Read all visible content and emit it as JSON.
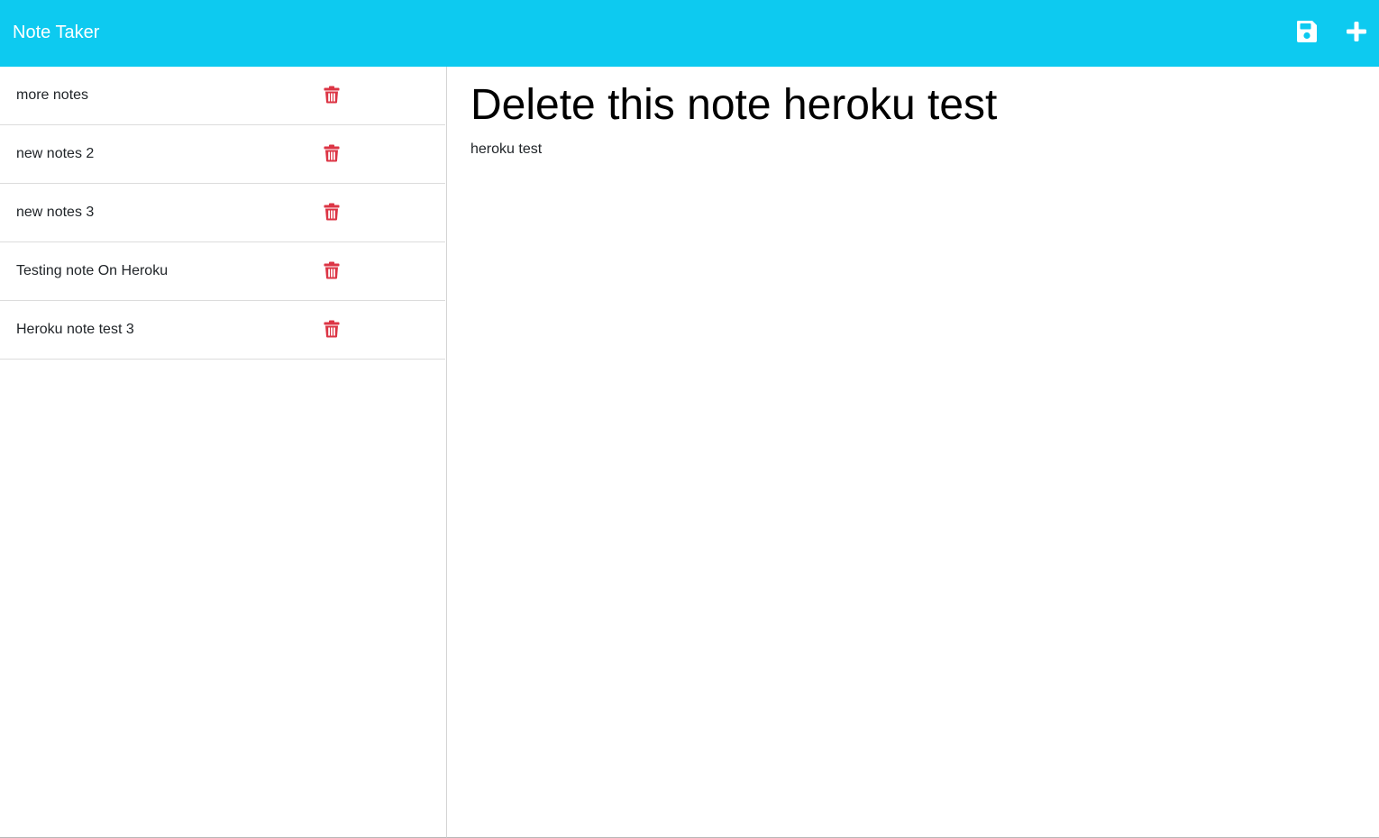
{
  "navbar": {
    "brand": "Note Taker",
    "save_icon": "floppy-disk-icon",
    "new_icon": "plus-icon",
    "background_color": "#0dcaf0"
  },
  "notes": [
    {
      "title": "more notes"
    },
    {
      "title": "new notes 2"
    },
    {
      "title": "new notes 3"
    },
    {
      "title": "Testing note On Heroku"
    },
    {
      "title": "Heroku note test 3"
    }
  ],
  "delete_icon": "trash-icon",
  "delete_icon_color": "#dc3545",
  "editor": {
    "title": "Delete this note heroku test",
    "text": "heroku test"
  }
}
